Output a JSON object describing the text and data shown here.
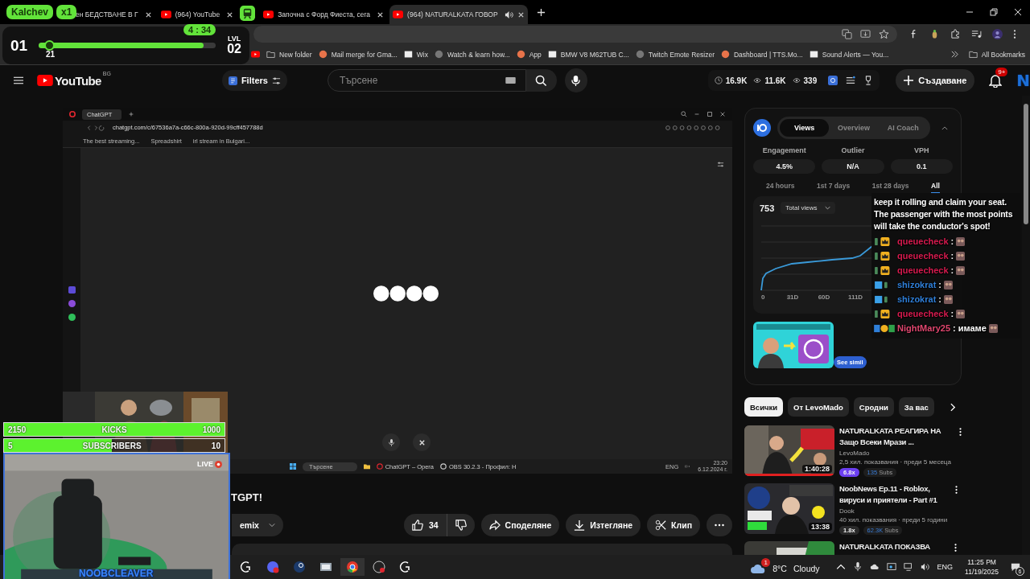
{
  "browser": {
    "tabs": [
      {
        "kind": "plain",
        "title": "ен БЕДСТВАНЕ В Г",
        "selected": false,
        "audio": false
      },
      {
        "kind": "video",
        "title": "(964) YouTube",
        "selected": false,
        "audio": false
      },
      {
        "kind": "video",
        "title": "Започна с Форд Фиеста, сега",
        "selected": false,
        "audio": false
      },
      {
        "kind": "video",
        "title": "(964) NATURALKATA ГОВОР",
        "selected": true,
        "audio": true
      }
    ],
    "bookmarks": [
      "New folder",
      "Mail merge for Gma...",
      "Wix",
      "Watch & learn how...",
      "App",
      "BMW V8 M62TUB C...",
      "Twitch Emote Resizer",
      "Dashboard | TTS.Mo...",
      "Sound Alerts — You..."
    ],
    "all_bookmarks": "All Bookmarks"
  },
  "stream_overlay": {
    "name": "Kalchev",
    "multiplier": "x1",
    "timer": "4 : 34",
    "level_current": "01",
    "progress_value": "21",
    "level_label": "LVL",
    "level_next": "02",
    "level": 0.93,
    "marker": {
      "level": 0.04
    },
    "goals": [
      {
        "start": "2150",
        "label": "KICKS",
        "end": "1000",
        "level": 1
      },
      {
        "start": "5",
        "label": "SUBSCRIBERS",
        "end": "10",
        "level": 0.49
      }
    ],
    "live": "LIVE",
    "streamer": "NOOBCLEAVER"
  },
  "youtube": {
    "header": {
      "logo": "YouTube",
      "region": "BG",
      "filters": "Filters",
      "search_placeholder": "Търсене",
      "stats": [
        "16.9K",
        "11.6K",
        "339"
      ],
      "create": "Създаване",
      "notifications": "9+",
      "avatar": "N"
    },
    "player": {
      "tab": "ChatGPT",
      "url": "chatgpt.com/c/67536a7a-c66c-800a-920d-99cff457788d",
      "bookmarks": [
        "The best streaming...",
        "Spreadshirt",
        "irl stream in Bulgari..."
      ],
      "taskbar": {
        "search": "Търсене",
        "apps": [
          "ChatGPT – Opera",
          "OBS 30.2.3 - Профил: Н"
        ],
        "language": "ENG",
        "time": "23:20",
        "date": "6.12.2024 г."
      }
    },
    "video": {
      "title": "TGPT!",
      "remix": "emix",
      "likes": "34",
      "actions": [
        {
          "kind": "share",
          "label": "Споделяне"
        },
        {
          "kind": "download",
          "label": "Изтегляне"
        },
        {
          "kind": "clip",
          "label": "Клип"
        }
      ]
    },
    "insights": {
      "tabs": [
        {
          "label": "Views",
          "selected": true
        },
        {
          "label": "Overview",
          "selected": false
        },
        {
          "label": "AI Coach",
          "selected": false
        }
      ],
      "metrics": [
        {
          "label": "Engagement",
          "value": "4.5%"
        },
        {
          "label": "Outlier",
          "value": "N/A"
        },
        {
          "label": "VPH",
          "value": "0.1"
        }
      ],
      "periods": [
        {
          "label": "24 hours",
          "selected": false
        },
        {
          "label": "1st 7 days",
          "selected": false
        },
        {
          "label": "1st 28 days",
          "selected": false
        },
        {
          "label": "All",
          "selected": true
        }
      ],
      "total": "753",
      "metric_select": "Total views",
      "x_labels": [
        "0",
        "31D",
        "60D",
        "111D"
      ],
      "card": {
        "button": "See simil"
      }
    },
    "chips": [
      {
        "label": "Всички",
        "selected": true
      },
      {
        "label": "От LevoMado",
        "selected": false
      },
      {
        "label": "Сродни",
        "selected": false
      },
      {
        "label": "За вас",
        "selected": false
      }
    ],
    "recommendations": [
      {
        "kind": "reaction",
        "title": "NATURALKATA РЕАГИРА НА Защо Всеки Мрази ...",
        "channel": "LevoMado",
        "meta": "2,5 хил. показвания · преди 5 месеца",
        "duration": "1:40:28",
        "ratio": "6.8x",
        "color": "#6c3ff0",
        "subs": "135",
        "subs_label": "Subs"
      },
      {
        "kind": "gamer",
        "title": "NoobNews Ep.11 - Roblox, вируси и приятели - Part #1",
        "channel": "Dook",
        "meta": "40 хил. показвания · преди 5 години",
        "duration": "13:38",
        "ratio": "1.8x",
        "color": "#2a2a2a",
        "subs": "62.3K",
        "subs_label": "Subs"
      },
      {
        "kind": "collection",
        "title": "NATURALKATA ПОКАЗВА"
      }
    ]
  },
  "chat": {
    "notice": "keep it rolling and claim your seat. The passenger with the most points will take the conductor's spot!",
    "messages": [
      {
        "kind": "crown",
        "user": "queuecheck",
        "color": "#d81b4f",
        "text": ":"
      },
      {
        "kind": "crown",
        "user": "queuecheck",
        "color": "#d81b4f",
        "text": ":"
      },
      {
        "kind": "crown",
        "user": "queuecheck",
        "color": "#d81b4f",
        "text": ":"
      },
      {
        "kind": "cube",
        "user": "shizokrat",
        "color": "#2f7fd8",
        "text": ":"
      },
      {
        "kind": "cube",
        "user": "shizokrat",
        "color": "#2f7fd8",
        "text": ":"
      },
      {
        "kind": "crown",
        "user": "queuecheck",
        "color": "#d81b4f",
        "text": ":"
      },
      {
        "kind": "multi",
        "user": "NightMary25",
        "color": "#e0476f",
        "text": ": имаме"
      }
    ]
  },
  "taskbar": {
    "weather": {
      "temp": "8°C",
      "condition": "Cloudy",
      "alerts": "1"
    },
    "language": "ENG",
    "time": "11:25 PM",
    "date": "11/19/2025",
    "notifications": "6"
  }
}
